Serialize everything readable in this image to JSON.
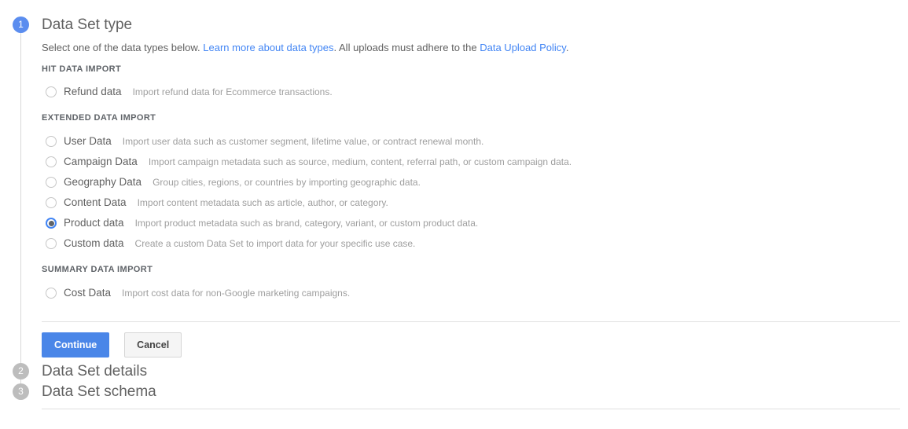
{
  "steps": [
    {
      "number": "1",
      "title": "Data Set type",
      "state": "active"
    },
    {
      "number": "2",
      "title": "Data Set details",
      "state": "inactive"
    },
    {
      "number": "3",
      "title": "Data Set schema",
      "state": "inactive"
    }
  ],
  "subtitle": {
    "lead": "Select one of the data types below. ",
    "link_data_types": "Learn more about data types",
    "middle": ". All uploads must adhere to the ",
    "link_policy": "Data Upload Policy",
    "tail": "."
  },
  "groups": [
    {
      "label": "HIT DATA IMPORT",
      "options": [
        {
          "label": "Refund data",
          "description": "Import refund data for Ecommerce transactions.",
          "selected": false
        }
      ]
    },
    {
      "label": "EXTENDED DATA IMPORT",
      "options": [
        {
          "label": "User Data",
          "description": "Import user data such as customer segment, lifetime value, or contract renewal month.",
          "selected": false
        },
        {
          "label": "Campaign Data",
          "description": "Import campaign metadata such as source, medium, content, referral path, or custom campaign data.",
          "selected": false
        },
        {
          "label": "Geography Data",
          "description": "Group cities, regions, or countries by importing geographic data.",
          "selected": false
        },
        {
          "label": "Content Data",
          "description": "Import content metadata such as article, author, or category.",
          "selected": false
        },
        {
          "label": "Product data",
          "description": "Import product metadata such as brand, category, variant, or custom product data.",
          "selected": true
        },
        {
          "label": "Custom data",
          "description": "Create a custom Data Set to import data for your specific use case.",
          "selected": false
        }
      ]
    },
    {
      "label": "SUMMARY DATA IMPORT",
      "options": [
        {
          "label": "Cost Data",
          "description": "Import cost data for non-Google marketing campaigns.",
          "selected": false
        }
      ]
    }
  ],
  "actions": {
    "continue_label": "Continue",
    "cancel_label": "Cancel"
  },
  "colors": {
    "accent": "#4285f4",
    "primary_button": "#4a86e8",
    "active_bullet": "#5b8def",
    "inactive_bullet": "#bdbdbd",
    "link": "#4285f4",
    "text": "#616161",
    "muted_text": "#9e9e9e",
    "divider": "#e0e0e0"
  }
}
